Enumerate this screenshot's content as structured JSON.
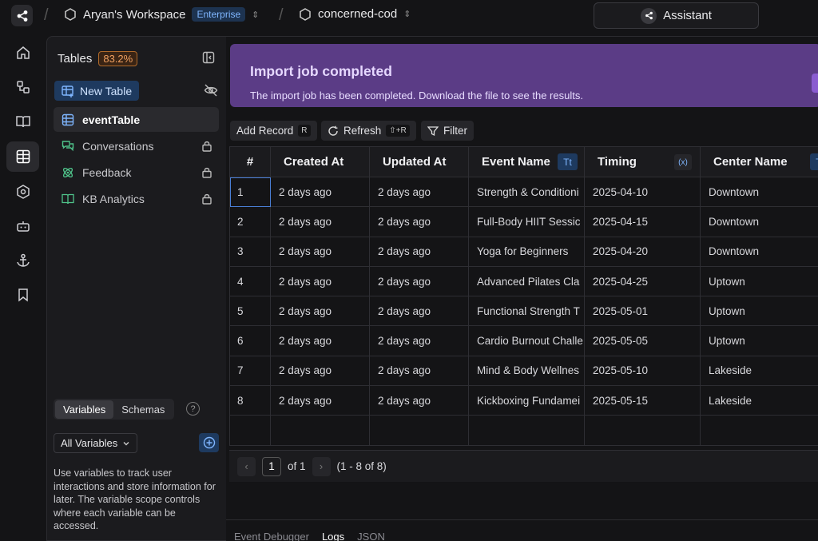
{
  "topbar": {
    "workspace_name": "Aryan's Workspace",
    "plan_badge": "Enterprise",
    "project_name": "concerned-cod",
    "assistant_label": "Assistant"
  },
  "tables_panel": {
    "title": "Tables",
    "usage_percent": "83.2%",
    "new_table_label": "New Table",
    "items": [
      {
        "label": "eventTable",
        "icon": "table-icon",
        "locked": false,
        "active": true
      },
      {
        "label": "Conversations",
        "icon": "chat-icon",
        "locked": true,
        "active": false
      },
      {
        "label": "Feedback",
        "icon": "atom-icon",
        "locked": true,
        "active": false
      },
      {
        "label": "KB Analytics",
        "icon": "book-icon",
        "locked": true,
        "active": false
      }
    ]
  },
  "variables": {
    "tabs": [
      "Variables",
      "Schemas"
    ],
    "help": "?",
    "filter_label": "All Variables",
    "help_text": "Use variables to track user interactions and store information for later. The variable scope controls where each variable can be accessed."
  },
  "banner": {
    "title": "Import job completed",
    "text": "The import job has been completed. Download the file to see the results."
  },
  "toolbar": {
    "add_record_label": "Add Record",
    "add_record_kbd": "R",
    "refresh_label": "Refresh",
    "refresh_kbd": "⇧+R",
    "filter_label": "Filter"
  },
  "table": {
    "columns": [
      "#",
      "Created At",
      "Updated At",
      "Event Name",
      "Timing",
      "Center Name"
    ],
    "type_badges": {
      "event_name": "Tt",
      "timing": "(x)",
      "center_name": "Tt"
    },
    "rows": [
      [
        "1",
        "2 days ago",
        "2 days ago",
        "Strength & Conditioni",
        "2025-04-10",
        "Downtown"
      ],
      [
        "2",
        "2 days ago",
        "2 days ago",
        "Full-Body HIIT Sessic",
        "2025-04-15",
        "Downtown"
      ],
      [
        "3",
        "2 days ago",
        "2 days ago",
        "Yoga for Beginners",
        "2025-04-20",
        "Downtown"
      ],
      [
        "4",
        "2 days ago",
        "2 days ago",
        "Advanced Pilates Cla",
        "2025-04-25",
        "Uptown"
      ],
      [
        "5",
        "2 days ago",
        "2 days ago",
        "Functional Strength T",
        "2025-05-01",
        "Uptown"
      ],
      [
        "6",
        "2 days ago",
        "2 days ago",
        "Cardio Burnout Challe",
        "2025-05-05",
        "Uptown"
      ],
      [
        "7",
        "2 days ago",
        "2 days ago",
        "Mind & Body Wellnes",
        "2025-05-10",
        "Lakeside"
      ],
      [
        "8",
        "2 days ago",
        "2 days ago",
        "Kickboxing Fundamei",
        "2025-05-15",
        "Lakeside"
      ]
    ]
  },
  "pagination": {
    "page": "1",
    "of_label": "of 1",
    "range": "(1 - 8 of 8)"
  },
  "bottom_tabs": [
    "Event Debugger",
    "Logs",
    "JSON"
  ]
}
